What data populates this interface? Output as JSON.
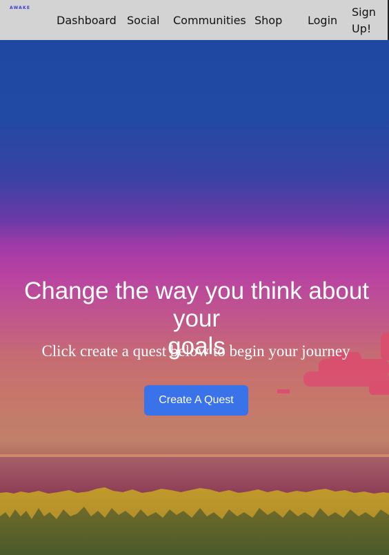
{
  "nav": {
    "logo": "AWAKE",
    "links": [
      "Dashboard",
      "Social",
      "Communities",
      "Shop"
    ],
    "login": "Login",
    "signup_line1": "Sign",
    "signup_line2": "Up!"
  },
  "hero": {
    "title_line1": "Change the way you think about your",
    "title_line2": "goals",
    "subtitle": "Click create a quest below to begin your journey",
    "cta_label": "Create A Quest"
  },
  "colors": {
    "accent": "#3a72ea",
    "nav_bg": "#d3d3d3",
    "logo": "#3a3ad6"
  }
}
